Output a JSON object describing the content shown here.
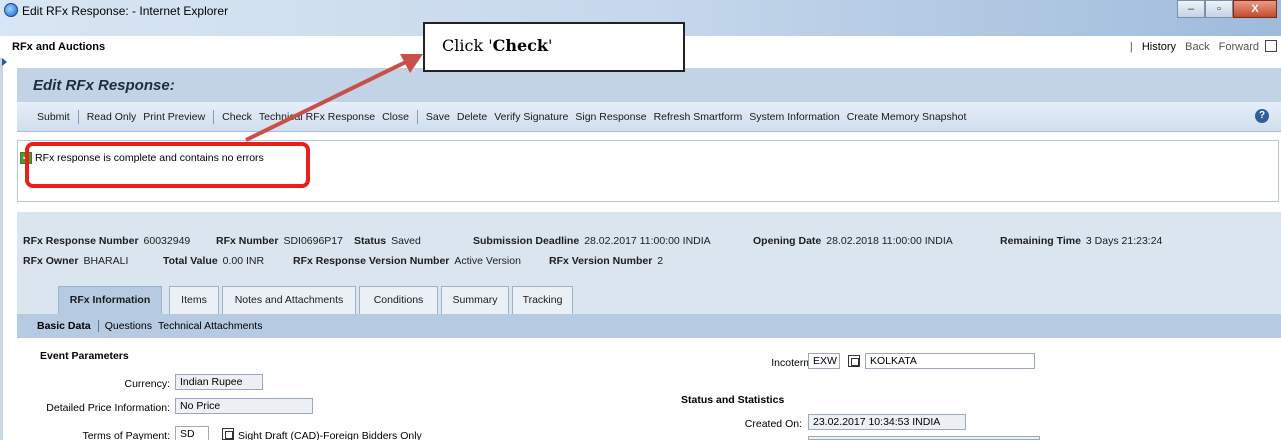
{
  "window": {
    "title": "Edit RFx Response: - Internet Explorer",
    "min": "–",
    "max": "▫",
    "close": "X"
  },
  "app": {
    "title": "RFx and Auctions",
    "nav": {
      "sep": "|",
      "history": "History",
      "back": "Back",
      "forward": "Forward"
    }
  },
  "page": {
    "title": "Edit RFx Response:"
  },
  "toolbar": {
    "group1": [
      "Submit"
    ],
    "group2": [
      "Read Only",
      "Print Preview"
    ],
    "group3": [
      "Check",
      "Technical RFx Response",
      "Close"
    ],
    "group4": [
      "Save",
      "Delete",
      "Verify Signature",
      "Sign Response",
      "Refresh Smartform",
      "System Information",
      "Create Memory Snapshot"
    ],
    "help": "?"
  },
  "message": {
    "text": "RFx response is complete and contains no errors",
    "icon": "check-icon"
  },
  "callout": {
    "prefix": "Click '",
    "bold": "Check",
    "suffix": "'"
  },
  "info": {
    "response_number_label": "RFx Response Number",
    "response_number": "60032949",
    "rfx_number_label": "RFx Number",
    "rfx_number": "SDI0696P17",
    "status_label": "Status",
    "status": "Saved",
    "deadline_label": "Submission Deadline",
    "deadline": "28.02.2017 11:00:00 INDIA",
    "opening_label": "Opening Date",
    "opening": "28.02.2018 11:00:00 INDIA",
    "remaining_label": "Remaining Time",
    "remaining": "3 Days 21:23:24",
    "owner_label": "RFx Owner",
    "owner": "BHARALI",
    "total_label": "Total Value",
    "total": "0.00 INR",
    "resp_version_label": "RFx Response Version Number",
    "resp_version": "Active Version",
    "rfx_version_label": "RFx Version Number",
    "rfx_version": "2"
  },
  "tabs": [
    "RFx Information",
    "Items",
    "Notes and Attachments",
    "Conditions",
    "Summary",
    "Tracking"
  ],
  "subtabs": [
    "Basic Data",
    "Questions",
    "Technical Attachments"
  ],
  "event": {
    "title": "Event Parameters",
    "currency_label": "Currency:",
    "currency": "Indian Rupee",
    "price_info_label": "Detailed Price Information:",
    "price_info": "No Price",
    "terms_label": "Terms of Payment:",
    "terms_code": "SD",
    "terms_text": "Sight Draft (CAD)-Foreign Bidders Only"
  },
  "incoterm": {
    "label": "Incoterm:",
    "code": "EXW",
    "location": "KOLKATA"
  },
  "stats": {
    "title": "Status and Statistics",
    "created_label": "Created On:",
    "created": "23.02.2017 10:34:53 INDIA"
  },
  "colors": {
    "highlight": "#e8201a",
    "arrow": "#c9504a",
    "header_bg": "#c3d3e6",
    "panel_bg": "#dbe5ef"
  }
}
